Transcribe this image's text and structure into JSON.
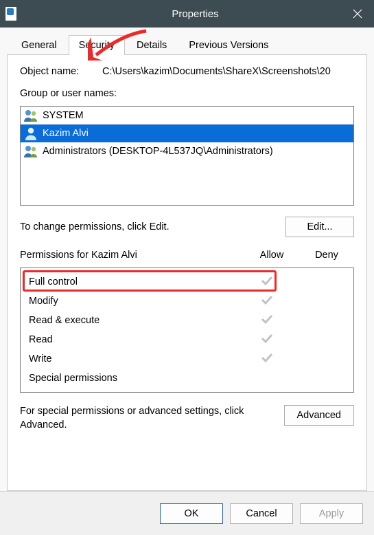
{
  "window": {
    "title": "Properties"
  },
  "tabs": [
    {
      "id": "general",
      "label": "General",
      "active": false
    },
    {
      "id": "security",
      "label": "Security",
      "active": true
    },
    {
      "id": "details",
      "label": "Details",
      "active": false
    },
    {
      "id": "previous",
      "label": "Previous Versions",
      "active": false
    }
  ],
  "object": {
    "label": "Object name:",
    "value": "C:\\Users\\kazim\\Documents\\ShareX\\Screenshots\\20"
  },
  "group_label": "Group or user names:",
  "users": [
    {
      "name": "SYSTEM",
      "selected": false,
      "icon": "two-people"
    },
    {
      "name": "Kazim Alvi",
      "selected": true,
      "icon": "one-person"
    },
    {
      "name": "Administrators (DESKTOP-4L537JQ\\Administrators)",
      "selected": false,
      "icon": "two-people"
    }
  ],
  "edit": {
    "text": "To change permissions, click Edit.",
    "button": "Edit..."
  },
  "perm_header": {
    "name": "Permissions for Kazim Alvi",
    "allow": "Allow",
    "deny": "Deny"
  },
  "permissions": [
    {
      "name": "Full control",
      "allow": true,
      "deny": false,
      "highlighted": true
    },
    {
      "name": "Modify",
      "allow": true,
      "deny": false,
      "highlighted": false
    },
    {
      "name": "Read & execute",
      "allow": true,
      "deny": false,
      "highlighted": false
    },
    {
      "name": "Read",
      "allow": true,
      "deny": false,
      "highlighted": false
    },
    {
      "name": "Write",
      "allow": true,
      "deny": false,
      "highlighted": false
    },
    {
      "name": "Special permissions",
      "allow": false,
      "deny": false,
      "highlighted": false
    }
  ],
  "advanced": {
    "text": "For special permissions or advanced settings, click Advanced.",
    "button": "Advanced"
  },
  "footer": {
    "ok": "OK",
    "cancel": "Cancel",
    "apply": "Apply"
  },
  "annotation": {
    "arrow_color": "#ec2a2a"
  }
}
